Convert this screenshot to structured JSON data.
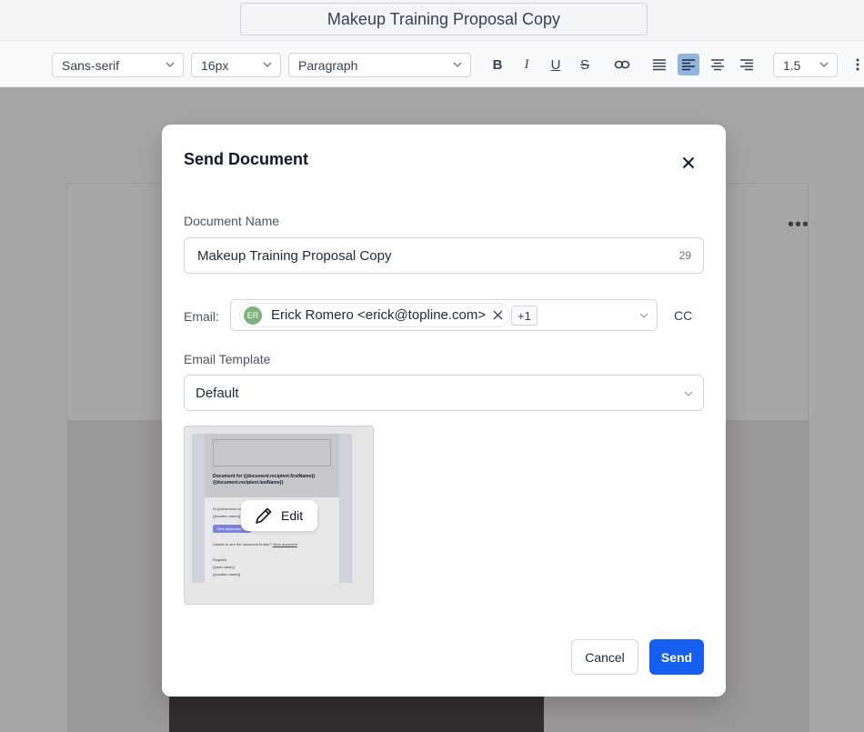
{
  "document": {
    "title": "Makeup Training Proposal Copy"
  },
  "toolbar": {
    "font_family": "Sans-serif",
    "font_size": "16px",
    "block_type": "Paragraph",
    "bold": "B",
    "italic": "I",
    "underline": "U",
    "strikethrough": "S",
    "line_height": "1.5",
    "active_button": "align-left",
    "active_color": "#93b4e0"
  },
  "modal": {
    "title": "Send Document",
    "document_name_label": "Document Name",
    "document_name_value": "Makeup Training Proposal Copy",
    "document_name_count": "29",
    "email_label": "Email:",
    "recipient": {
      "initials": "ER",
      "display": "Erick Romero <erick@topline.com>"
    },
    "extra_recipients": "+1",
    "cc_label": "CC",
    "email_template_label": "Email Template",
    "email_template_value": "Default",
    "preview": {
      "heading": "Document for {{document.recipient.firstName}} {{document.recipient.lastName}}",
      "line1": "Hi {{document.recipient.firstName}},",
      "line2": "{{location.name}} has sent you a document",
      "button": "View document",
      "line3": "Unable to see the document button?",
      "link": "View document",
      "regards": "Regards",
      "sender": "{{user.name}}",
      "location": "{{location.name}}"
    },
    "edit_label": "Edit",
    "cancel_label": "Cancel",
    "send_label": "Send",
    "send_color": "#155eef"
  }
}
